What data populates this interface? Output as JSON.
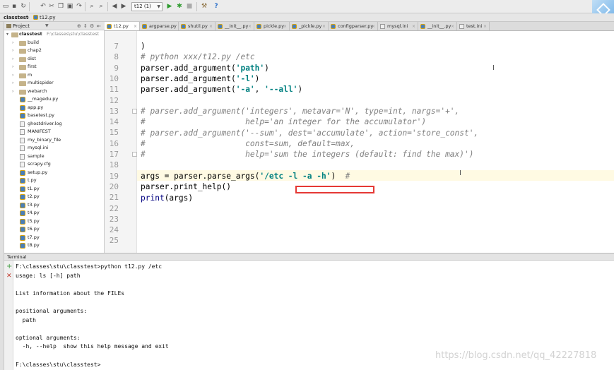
{
  "toolbar": {
    "run_config": "t12 (1)",
    "help": "?"
  },
  "breadcrumb": [
    "classtest",
    "t12.py"
  ],
  "project_panel": {
    "title": "Project",
    "root_name": "classtest",
    "root_path": "F:\\classes\\stu\\classtest",
    "items": [
      {
        "name": "build",
        "type": "folder"
      },
      {
        "name": "chap2",
        "type": "folder"
      },
      {
        "name": "dist",
        "type": "folder"
      },
      {
        "name": "first",
        "type": "folder"
      },
      {
        "name": "m",
        "type": "folder"
      },
      {
        "name": "multispider",
        "type": "folder"
      },
      {
        "name": "webarch",
        "type": "folder"
      },
      {
        "name": "__magedu.py",
        "type": "py"
      },
      {
        "name": "app.py",
        "type": "py"
      },
      {
        "name": "basetest.py",
        "type": "py"
      },
      {
        "name": "ghostdriver.log",
        "type": "file"
      },
      {
        "name": "MANIFEST",
        "type": "file"
      },
      {
        "name": "my_binary_file",
        "type": "file"
      },
      {
        "name": "mysql.ini",
        "type": "file"
      },
      {
        "name": "sample",
        "type": "file"
      },
      {
        "name": "scrapy.cfg",
        "type": "file"
      },
      {
        "name": "setup.py",
        "type": "py"
      },
      {
        "name": "t.py",
        "type": "py"
      },
      {
        "name": "t1.py",
        "type": "py"
      },
      {
        "name": "t2.py",
        "type": "py"
      },
      {
        "name": "t3.py",
        "type": "py"
      },
      {
        "name": "t4.py",
        "type": "py"
      },
      {
        "name": "t5.py",
        "type": "py"
      },
      {
        "name": "t6.py",
        "type": "py"
      },
      {
        "name": "t7.py",
        "type": "py"
      },
      {
        "name": "t8.py",
        "type": "py"
      }
    ]
  },
  "editor_tabs": [
    {
      "label": "t12.py",
      "type": "py",
      "active": true
    },
    {
      "label": "argparse.py",
      "type": "py"
    },
    {
      "label": "shutil.py",
      "type": "py"
    },
    {
      "label": "__init__.py",
      "type": "py"
    },
    {
      "label": "pickle.py",
      "type": "py"
    },
    {
      "label": "_pickle.py",
      "type": "py"
    },
    {
      "label": "configparser.py",
      "type": "py"
    },
    {
      "label": "mysql.ini",
      "type": "txt"
    },
    {
      "label": "__init__.py",
      "type": "py"
    },
    {
      "label": "test.ini",
      "type": "txt"
    }
  ],
  "editor": {
    "line_numbers": [
      "7",
      "8",
      "9",
      "10",
      "11",
      "12",
      "13",
      "14",
      "15",
      "16",
      "17",
      "18",
      "19",
      "20",
      "21",
      "22",
      "23",
      "24",
      "25"
    ],
    "lines": {
      "l7": ")",
      "l8": "# python xxx/t12.py /etc",
      "l9_pre": "parser.add_argument(",
      "l9_str": "'path'",
      "l9_post": ")",
      "l10_pre": "parser.add_argument(",
      "l10_str": "'-l'",
      "l10_post": ")",
      "l11_pre": "parser.add_argument(",
      "l11_str1": "'-a'",
      "l11_mid": ", ",
      "l11_str2": "'--all'",
      "l11_post": ")",
      "l13": "# parser.add_argument('integers', metavar='N', type=int, nargs='+',",
      "l14": "#                     help='an integer for the accumulator')",
      "l15": "# parser.add_argument('--sum', dest='accumulate', action='store_const',",
      "l16": "#                     const=sum, default=max,",
      "l17": "#                     help='sum the integers (default: find the max)')",
      "l19_pre": "args = parser.parse_args(",
      "l19_str": "'/etc -l -a -h'",
      "l19_post": ")  ",
      "l19_cm": "#",
      "l20": "parser.print_help()",
      "l21_fn": "print",
      "l21_post": "(args)"
    }
  },
  "terminal": {
    "title": "Terminal",
    "lines": [
      "F:\\classes\\stu\\classtest>python t12.py /etc",
      "usage: ls [-h] path",
      "",
      "List information about the FILEs",
      "",
      "positional arguments:",
      "  path",
      "",
      "optional arguments:",
      "  -h, --help  show this help message and exit",
      "",
      "F:\\classes\\stu\\classtest>"
    ]
  },
  "watermark": "https://blog.csdn.net/qq_42227818"
}
